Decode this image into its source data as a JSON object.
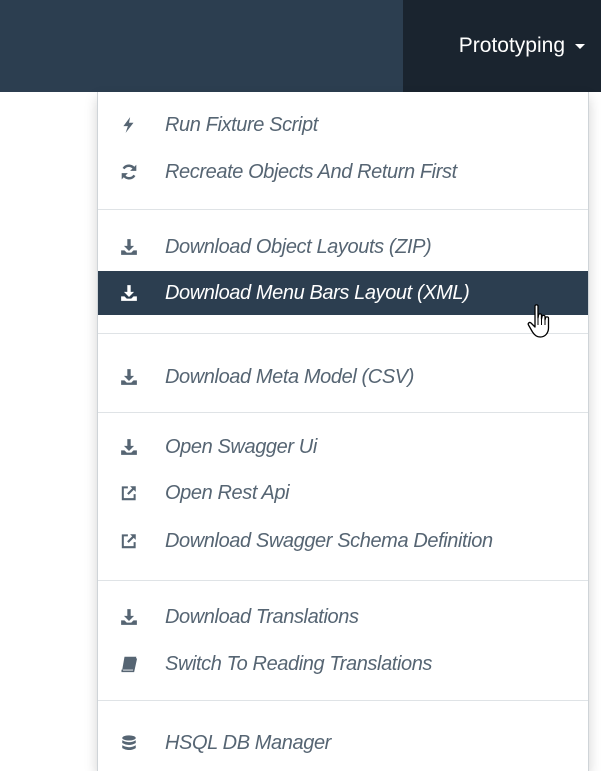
{
  "navbar": {
    "menu_label": "Prototyping"
  },
  "colors": {
    "navbar": "#2c3e50",
    "navbar_active": "#1a242f",
    "item_text": "#566573",
    "highlight": "#2c3e50"
  },
  "dropdown": {
    "groups": [
      {
        "items": [
          {
            "label": "Run Fixture Script",
            "icon": "bolt-icon"
          },
          {
            "label": "Recreate Objects And Return First",
            "icon": "refresh-icon"
          }
        ]
      },
      {
        "items": [
          {
            "label": "Download Object Layouts (ZIP)",
            "icon": "download-icon"
          },
          {
            "label": "Download Menu Bars Layout (XML)",
            "icon": "download-icon",
            "highlighted": true
          }
        ]
      },
      {
        "items": [
          {
            "label": "Download Meta Model (CSV)",
            "icon": "download-icon"
          }
        ]
      },
      {
        "items": [
          {
            "label": "Open Swagger Ui",
            "icon": "download-icon"
          },
          {
            "label": "Open Rest Api",
            "icon": "external-link-icon"
          },
          {
            "label": "Download Swagger Schema Definition",
            "icon": "external-link-icon"
          }
        ]
      },
      {
        "items": [
          {
            "label": "Download Translations",
            "icon": "download-icon"
          },
          {
            "label": "Switch To Reading Translations",
            "icon": "book-icon"
          }
        ]
      },
      {
        "items": [
          {
            "label": "HSQL DB Manager",
            "icon": "database-icon"
          }
        ]
      }
    ]
  }
}
